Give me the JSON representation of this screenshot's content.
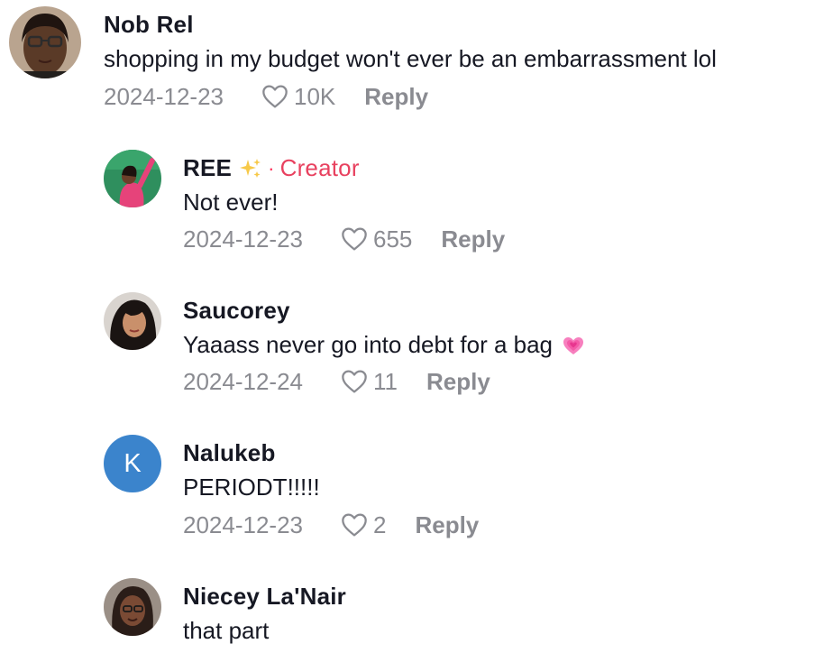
{
  "comments": [
    {
      "author": "Nob Rel",
      "text": "shopping in my budget won't ever be an embarrassment lol",
      "date": "2024-12-23",
      "likes": "10K",
      "reply_label": "Reply"
    },
    {
      "author": "REE",
      "author_emoji": "sparkles-emoji",
      "separator": "·",
      "badge": "Creator",
      "text": "Not ever!",
      "date": "2024-12-23",
      "likes": "655",
      "reply_label": "Reply"
    },
    {
      "author": "Saucorey",
      "text": "Yaaass never go into debt for a bag",
      "text_emoji": "growing-heart-emoji",
      "date": "2024-12-24",
      "likes": "11",
      "reply_label": "Reply"
    },
    {
      "author": "Nalukeb",
      "avatar_letter": "K",
      "text": "PERIODT!!!!!",
      "date": "2024-12-23",
      "likes": "2",
      "reply_label": "Reply"
    },
    {
      "author": "Niecey La'Nair",
      "text": "that part"
    }
  ],
  "colors": {
    "text": "#161823",
    "muted": "#8a8b91",
    "creator": "#e8415f",
    "letter_avatar": "#3b84cc"
  },
  "icons": {
    "like": "heart-outline-icon"
  }
}
